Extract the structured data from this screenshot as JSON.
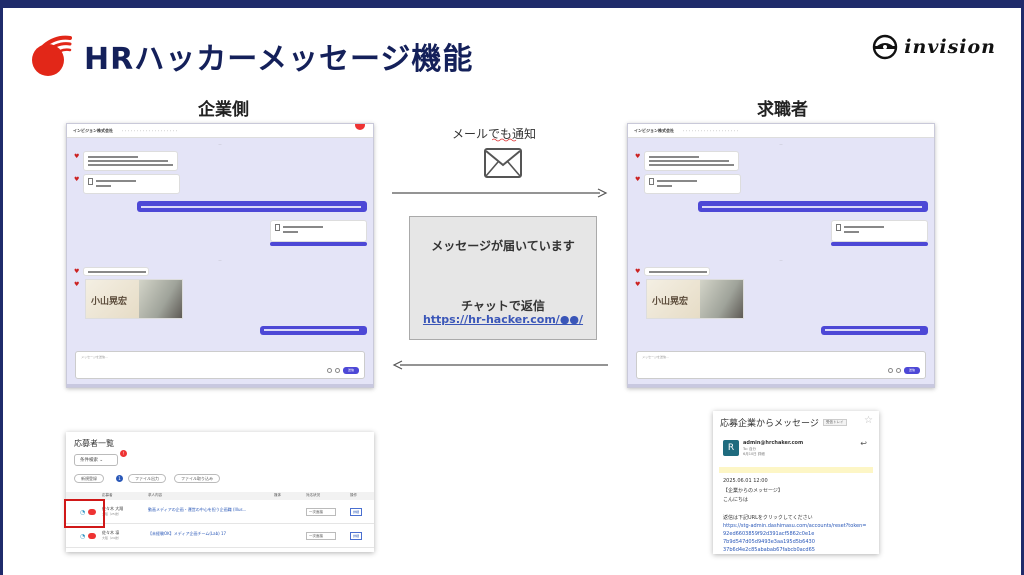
{
  "slide": {
    "title": "HRハッカーメッセージ機能",
    "brand": "invision"
  },
  "labels": {
    "company": "企業側",
    "seeker": "求職者"
  },
  "flow": {
    "email_label": "メールでも通知"
  },
  "notification": {
    "line1": "メッセージが届いています",
    "line2": "チャットで返信",
    "link": "https://hr-hacker.com/●●/"
  },
  "chat_window": {
    "company": "インビジョン株式会社",
    "photo_name": "小山晃宏",
    "input_placeholder": "メッセージを送信...",
    "send_label": "送信"
  },
  "applicant_list": {
    "title": "応募者一覧",
    "search_label": "条件検索 ⌄",
    "search_badge": "!",
    "pills": [
      "新規登録",
      "ファイル出力",
      "ファイル取り込み"
    ],
    "pill_badge": "1",
    "columns": [
      "",
      "応募者",
      "求人内容",
      "媒体",
      "対応状況",
      "操作"
    ],
    "rows": [
      {
        "name": "佐々木 大翔",
        "sub": "大阪（25歳）",
        "job": "動画メディアの企画・運営の中心を担う企画職 (Illus...",
        "status": "一次面接",
        "action": "詳細"
      },
      {
        "name": "佐々木 凛",
        "sub": "大阪（24歳）",
        "job": "【未経験OK】メディア企画チーム(Lab) 17",
        "status": "一次面接",
        "action": "詳細"
      }
    ]
  },
  "email": {
    "subject": "応募企業からメッセージ",
    "tag": "受信トレイ",
    "avatar": "R",
    "from": "admin@hrchaker.com",
    "to": "To: 自分",
    "when": "6月10日 詳細",
    "lines": [
      "2025.06.01 12:00",
      "【企業からのメッセージ】",
      "こんにちは",
      "",
      "返信は下記URLをクリックしてください"
    ],
    "links": [
      "https://stg-admin.dashimasu.com/accounts/reset?token=",
      "92ed6603859f92d391acf5862c0e1e",
      "7b9d547d05d9493e3aa195d5b6430",
      "37b6d4e2c85ababab67fabcb0acd65"
    ]
  },
  "colors": {
    "title": "#14205a",
    "frame": "#1f2b6b",
    "accent_red": "#e22718",
    "chat_bg": "#e4e4f7",
    "bubble_out": "#4d48d6",
    "link": "#3a56b8"
  }
}
